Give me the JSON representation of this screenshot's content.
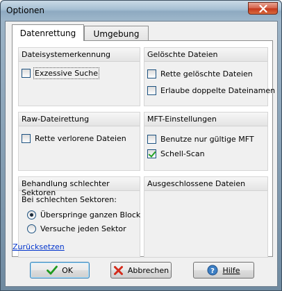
{
  "window": {
    "title": "Optionen"
  },
  "tabs": [
    {
      "label": "Datenrettung",
      "active": true
    },
    {
      "label": "Umgebung",
      "active": false
    }
  ],
  "groups": {
    "filesystem": {
      "title": "Dateisystemerkennung",
      "options": [
        {
          "label": "Exzessive Suche",
          "checked": false
        }
      ]
    },
    "deleted_files": {
      "title": "Gelöschte Dateien",
      "options": [
        {
          "label": "Rette gelöschte Dateien",
          "checked": false
        },
        {
          "label": "Erlaube doppelte Dateinamen",
          "checked": false
        }
      ]
    },
    "raw_recovery": {
      "title": "Raw-Dateirettung",
      "options": [
        {
          "label": "Rette verlorene Dateien",
          "checked": false
        }
      ]
    },
    "mft": {
      "title": "MFT-Einstellungen",
      "options": [
        {
          "label": "Benutze nur gültige MFT",
          "checked": false
        },
        {
          "label": "Schell-Scan",
          "checked": true
        }
      ]
    },
    "bad_sectors": {
      "title": "Behandlung schlechter Sektoren",
      "prompt": "Bei schlechten Sektoren:",
      "options": [
        {
          "label": "Überspringe ganzen Block",
          "selected": true
        },
        {
          "label": "Versuche jeden Sektor",
          "selected": false
        }
      ]
    },
    "excluded_files": {
      "title": "Ausgeschlossene Dateien"
    }
  },
  "reset_link": "Zurücksetzen",
  "buttons": {
    "ok": "OK",
    "cancel": "Abbrechen",
    "help": "Hilfe"
  },
  "icons": {
    "ok": "green-checkmark-icon",
    "cancel": "red-x-icon",
    "help": "help-question-icon",
    "close": "close-icon"
  },
  "colors": {
    "link": "#0033cc",
    "check": "#21a121",
    "cancel_x": "#d42a1a",
    "close_button": "#c5381c"
  }
}
